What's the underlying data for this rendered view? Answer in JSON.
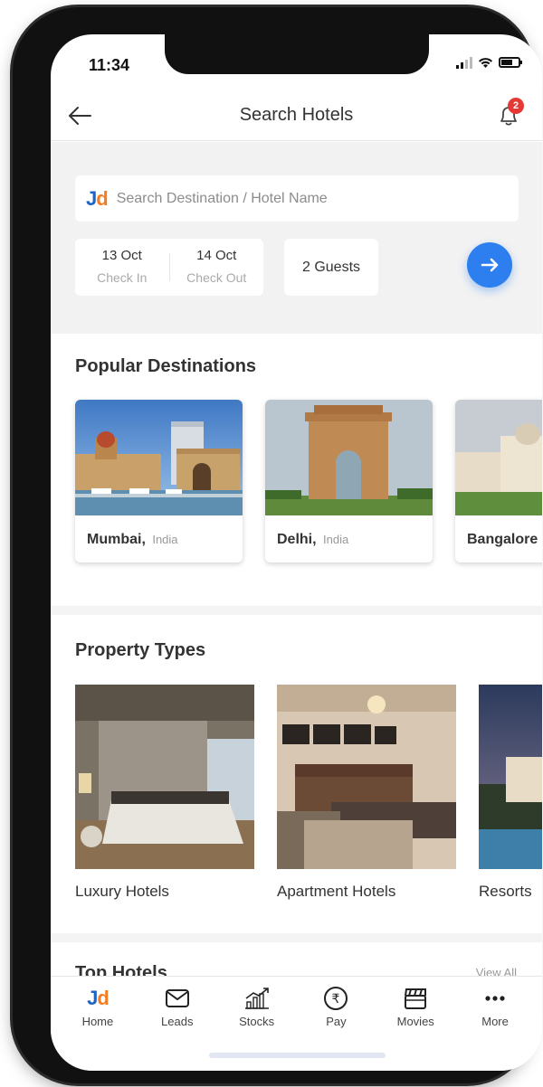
{
  "status_bar": {
    "time": "11:34"
  },
  "header": {
    "title": "Search Hotels",
    "notification_count": "2"
  },
  "search": {
    "logo": {
      "j": "J",
      "d": "d"
    },
    "placeholder": "Search Destination / Hotel Name",
    "check_in": {
      "date": "13 Oct",
      "label": "Check In"
    },
    "check_out": {
      "date": "14 Oct",
      "label": "Check Out"
    },
    "guests": "2 Guests"
  },
  "popular_destinations": {
    "title": "Popular Destinations",
    "items": [
      {
        "city": "Mumbai,",
        "country": "India"
      },
      {
        "city": "Delhi,",
        "country": "India"
      },
      {
        "city": "Bangalore",
        "country": ""
      }
    ]
  },
  "property_types": {
    "title": "Property Types",
    "items": [
      {
        "label": "Luxury Hotels"
      },
      {
        "label": "Apartment Hotels"
      },
      {
        "label": "Resorts"
      }
    ]
  },
  "top_hotels": {
    "title": "Top Hotels",
    "view_all": "View All"
  },
  "tabbar": {
    "items": [
      {
        "label": "Home",
        "icon": "jd-logo-icon"
      },
      {
        "label": "Leads",
        "icon": "envelope-icon"
      },
      {
        "label": "Stocks",
        "icon": "chart-icon"
      },
      {
        "label": "Pay",
        "icon": "rupee-icon"
      },
      {
        "label": "Movies",
        "icon": "clapperboard-icon"
      },
      {
        "label": "More",
        "icon": "more-dots-icon"
      }
    ]
  },
  "colors": {
    "accent": "#2d7ff0",
    "brand_blue": "#1e64c8",
    "brand_orange": "#f57c20",
    "badge": "#e53935"
  }
}
